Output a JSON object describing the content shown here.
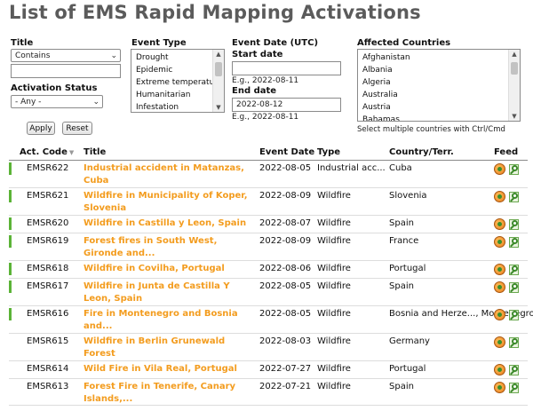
{
  "page": {
    "title": "List of EMS Rapid Mapping Activations"
  },
  "filters": {
    "title": {
      "label": "Title",
      "mode_value": "Contains",
      "text_value": ""
    },
    "activation_status": {
      "label": "Activation Status",
      "value": "- Any -"
    },
    "event_type": {
      "label": "Event Type",
      "options": [
        "Drought",
        "Epidemic",
        "Extreme temperatur",
        "Humanitarian",
        "Infestation"
      ]
    },
    "event_date": {
      "label": "Event Date (UTC)",
      "start_label": "Start date",
      "start_value": "",
      "start_hint": "E.g., 2022-08-11",
      "end_label": "End date",
      "end_value": "2022-08-12",
      "end_hint": "E.g., 2022-08-11"
    },
    "affected_countries": {
      "label": "Affected Countries",
      "options": [
        "Afghanistan",
        "Albania",
        "Algeria",
        "Australia",
        "Austria",
        "Bahamas"
      ],
      "hint": "Select multiple countries with Ctrl/Cmd"
    },
    "apply_label": "Apply",
    "reset_label": "Reset"
  },
  "table": {
    "headers": {
      "code": "Act. Code",
      "title": "Title",
      "date": "Event Date",
      "type": "Type",
      "country": "Country/Terr.",
      "feed": "Feed"
    },
    "rows": [
      {
        "code": "EMSR622",
        "title": "Industrial accident in Matanzas, Cuba",
        "date": "2022-08-05",
        "type": "Industrial acc...",
        "country": "Cuba",
        "active": true
      },
      {
        "code": "EMSR621",
        "title": "Wildfire in Municipality of Koper, Slovenia",
        "date": "2022-08-09",
        "type": "Wildfire",
        "country": "Slovenia",
        "active": true
      },
      {
        "code": "EMSR620",
        "title": "Wildfire in Castilla y Leon, Spain",
        "date": "2022-08-07",
        "type": "Wildfire",
        "country": "Spain",
        "active": true
      },
      {
        "code": "EMSR619",
        "title": "Forest fires in South West, Gironde and...",
        "date": "2022-08-09",
        "type": "Wildfire",
        "country": "France",
        "active": true
      },
      {
        "code": "EMSR618",
        "title": "Wildfire in Covilha, Portugal",
        "date": "2022-08-06",
        "type": "Wildfire",
        "country": "Portugal",
        "active": true
      },
      {
        "code": "EMSR617",
        "title": "Wildfire in Junta de Castilla Y Leon, Spain",
        "date": "2022-08-05",
        "type": "Wildfire",
        "country": "Spain",
        "active": true
      },
      {
        "code": "EMSR616",
        "title": "Fire in Montenegro and Bosnia and...",
        "date": "2022-08-05",
        "type": "Wildfire",
        "country": "Bosnia and Herze..., Montenegro",
        "active": true
      },
      {
        "code": "EMSR615",
        "title": "Wildfire in Berlin Grunewald Forest",
        "date": "2022-08-03",
        "type": "Wildfire",
        "country": "Germany",
        "active": false
      },
      {
        "code": "EMSR614",
        "title": "Wild Fire in Vila Real, Portugal",
        "date": "2022-07-27",
        "type": "Wildfire",
        "country": "Portugal",
        "active": false
      },
      {
        "code": "EMSR613",
        "title": "Forest Fire in Tenerife, Canary Islands,...",
        "date": "2022-07-21",
        "type": "Wildfire",
        "country": "Spain",
        "active": false
      }
    ]
  },
  "colors": {
    "title_link": "#f39c1e",
    "active_bar": "#5bb337",
    "heading": "#5b5b5b"
  }
}
